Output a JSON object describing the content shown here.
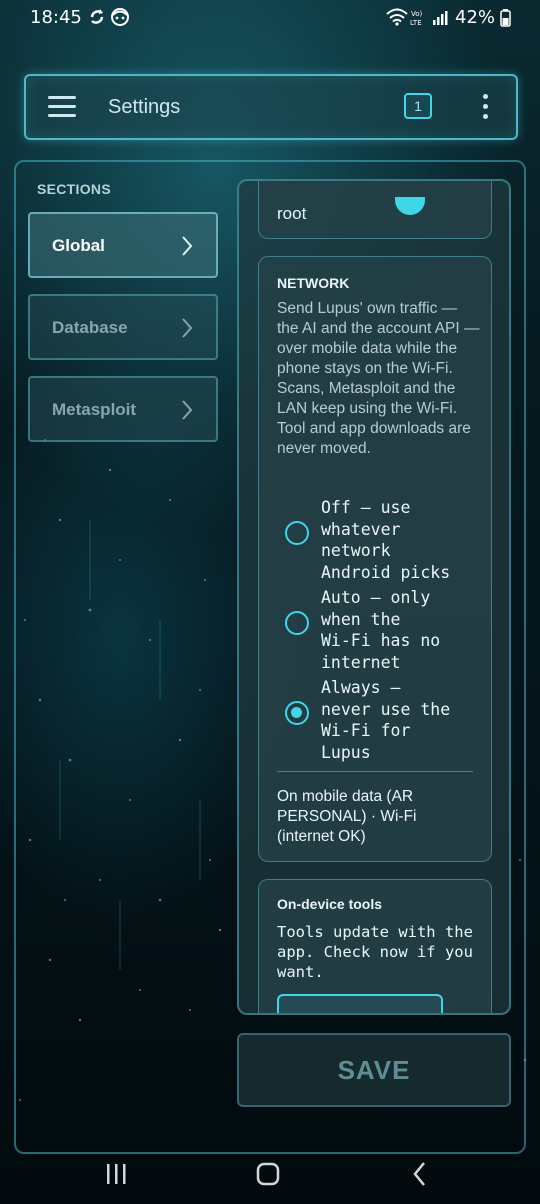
{
  "status_bar": {
    "time": "18:45",
    "battery": "42%",
    "icons": [
      "sync-icon",
      "face-icon",
      "wifi-icon",
      "volte-icon",
      "signal-icon",
      "battery-icon"
    ]
  },
  "app_bar": {
    "title": "Settings",
    "badge_count": "1",
    "menu_icon": "hamburger-icon",
    "more_icon": "more-vert-icon"
  },
  "sidebar": {
    "label": "SECTIONS",
    "items": [
      {
        "label": "Global",
        "active": true
      },
      {
        "label": "Database",
        "active": false
      },
      {
        "label": "Metasploit",
        "active": false
      }
    ]
  },
  "main": {
    "root_card": {
      "value": "root"
    },
    "network": {
      "heading": "NETWORK",
      "description": "Send Lupus' own traffic — the AI and the account API — over mobile data while the phone stays on the Wi-Fi. Scans, Metasploit and the LAN keep using the Wi-Fi. Tool and app downloads are never moved.",
      "options": [
        {
          "label": "Off — use\nwhatever\nnetwork\nAndroid picks",
          "selected": false
        },
        {
          "label": "Auto — only\nwhen the\nWi-Fi has no\ninternet",
          "selected": false
        },
        {
          "label": "Always —\nnever use the\nWi-Fi for\nLupus",
          "selected": true
        }
      ],
      "status": "On mobile data (AR PERSONAL) · Wi-Fi (internet OK)"
    },
    "tools": {
      "heading": "On-device tools",
      "description": "Tools update with the app. Check now if you want."
    }
  },
  "save_button": {
    "label": "SAVE"
  },
  "navbar": {
    "icons": [
      "recents-icon",
      "home-icon",
      "back-icon"
    ]
  },
  "colors": {
    "accent": "#3fd6e8",
    "panel": "#203a40",
    "background": "#04141a"
  }
}
